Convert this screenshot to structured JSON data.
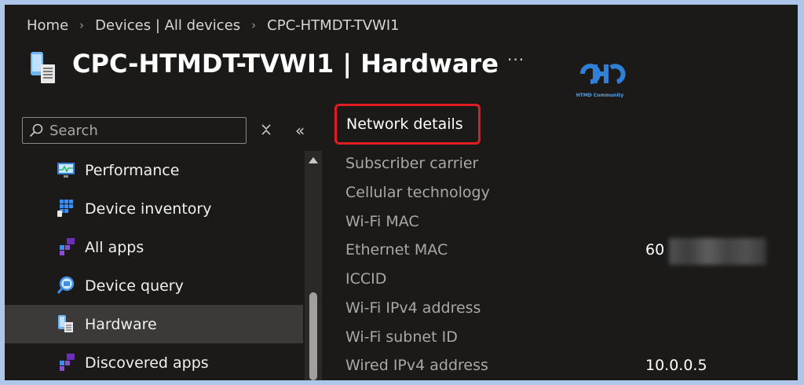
{
  "breadcrumb": [
    "Home",
    "Devices | All devices",
    "CPC-HTMDT-TVWI1"
  ],
  "header": {
    "title": "CPC-HTMDT-TVWI1 | Hardware",
    "more": "···"
  },
  "logo": {
    "caption": "HTMD Community"
  },
  "search": {
    "placeholder": "Search",
    "value": ""
  },
  "collapse_glyph": "«",
  "nav": {
    "items": [
      {
        "label": "Performance",
        "icon": "performance-icon",
        "selected": false
      },
      {
        "label": "Device inventory",
        "icon": "inventory-icon",
        "selected": false
      },
      {
        "label": "All apps",
        "icon": "apps-icon",
        "selected": false
      },
      {
        "label": "Device query",
        "icon": "query-icon",
        "selected": false
      },
      {
        "label": "Hardware",
        "icon": "hardware-icon",
        "selected": true
      },
      {
        "label": "Discovered apps",
        "icon": "discovered-apps-icon",
        "selected": false
      }
    ]
  },
  "network": {
    "heading": "Network details",
    "rows": [
      {
        "label": "Subscriber carrier",
        "value": ""
      },
      {
        "label": "Cellular technology",
        "value": ""
      },
      {
        "label": "Wi-Fi MAC",
        "value": ""
      },
      {
        "label": "Ethernet MAC",
        "value": "60"
      },
      {
        "label": "ICCID",
        "value": ""
      },
      {
        "label": "Wi-Fi IPv4 address",
        "value": ""
      },
      {
        "label": "Wi-Fi subnet ID",
        "value": ""
      },
      {
        "label": "Wired IPv4 address",
        "value": "10.0.0.5"
      }
    ]
  },
  "colors": {
    "background": "#1b1a19",
    "highlight_border": "#e11b22",
    "selected_nav": "#3b3a39",
    "frame": "#aec6ea"
  }
}
